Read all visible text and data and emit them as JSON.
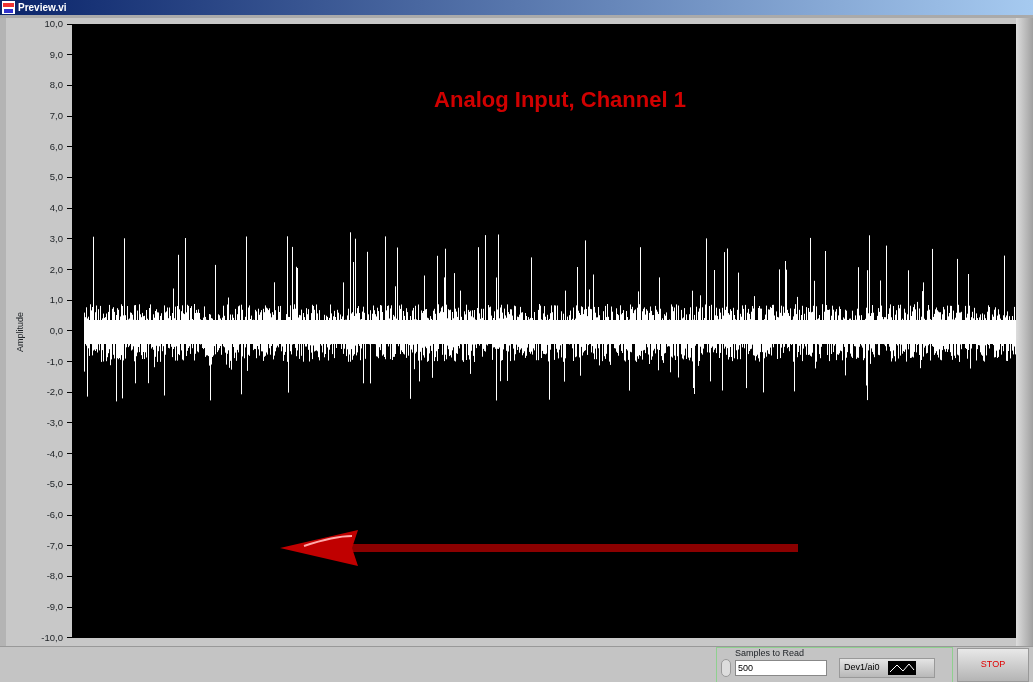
{
  "window": {
    "title": "Preview.vi"
  },
  "graph": {
    "title": "Analog Input, Channel 1",
    "ylabel": "Amplitude",
    "yticks": [
      "10,0",
      "9,0",
      "8,0",
      "7,0",
      "6,0",
      "5,0",
      "4,0",
      "3,0",
      "2,0",
      "1,0",
      "0,0",
      "-1,0",
      "-2,0",
      "-3,0",
      "-4,0",
      "-5,0",
      "-6,0",
      "-7,0",
      "-8,0",
      "-9,0",
      "-10,0"
    ]
  },
  "controls": {
    "samples_label": "Samples to Read",
    "samples_value": "500",
    "channel": "Dev1/ai0",
    "stop_button": "STOP"
  }
}
